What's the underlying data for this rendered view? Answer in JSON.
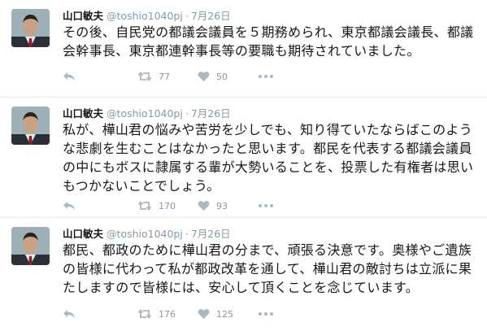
{
  "tweets": [
    {
      "name": "山口敏夫",
      "handle": "@toshio1040pj",
      "separator": "·",
      "date": "7月26日",
      "text": "その後、自民党の都議会議員を５期務められ、東京都議会議長、都議\n会幹事長、東京都連幹事長等の要職も期待されていました。",
      "retweets": "77",
      "likes": "50"
    },
    {
      "name": "山口敏夫",
      "handle": "@toshio1040pj",
      "separator": "·",
      "date": "7月26日",
      "text": "私が、樺山君の悩みや苦労を少しでも、知り得ていたならばこのよう\nな悲劇を生むことはなかったと思います。都民を代表する都議会議員\nの中にもボスに隷属する輩が大勢いることを、投票した有権者は思い\nもつかないことでしょう。",
      "retweets": "170",
      "likes": "93"
    },
    {
      "name": "山口敏夫",
      "handle": "@toshio1040pj",
      "separator": "·",
      "date": "7月26日",
      "text": "都民、都政のために樺山君の分まで、頑張る決意です。奥様やご遺族\nの皆様に代わって私が都政改革を通して、樺山君の敵討ちは立派に果\nたしますので皆様には、安心して頂くことを念じています。",
      "retweets": "176",
      "likes": "125"
    }
  ],
  "icons": {
    "reply": "reply-icon",
    "retweet": "retweet-icon",
    "like": "heart-icon",
    "more": "more-icon"
  },
  "colors": {
    "text": "#14171a",
    "meta": "#8899a6",
    "action": "#aab8c2",
    "divider": "#e6ecf0"
  }
}
